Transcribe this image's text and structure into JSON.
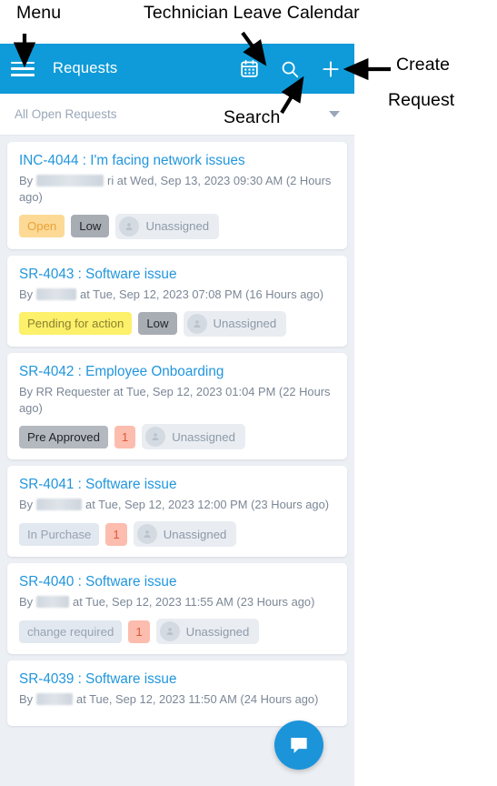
{
  "annotations": [
    {
      "key": "menu",
      "text": "Menu"
    },
    {
      "key": "calendar",
      "text": "Technician Leave Calendar"
    },
    {
      "key": "search",
      "text": "Search"
    },
    {
      "key": "create1",
      "text": "Create"
    },
    {
      "key": "create2",
      "text": "Request"
    }
  ],
  "header": {
    "title": "Requests",
    "menu_icon": "hamburger-menu-icon",
    "actions": [
      {
        "name": "calendar-icon",
        "label": "Technician Leave Calendar"
      },
      {
        "name": "search-icon",
        "label": "Search"
      },
      {
        "name": "plus-icon",
        "label": "Create Request"
      }
    ]
  },
  "filter_bar": {
    "selected": "All Open Requests",
    "caret_icon": "chevron-down-icon"
  },
  "colors": {
    "header_blue": "#0f9bd9",
    "title_blue": "#2196dd",
    "fab_blue": "#1b94da",
    "page_bg": "#eceff3",
    "open_chip_bg": "#fcd995",
    "open_chip_text": "#e8a33a",
    "pending_chip_bg": "#fdf06a",
    "pending_chip_text": "#8a8330",
    "low_chip_bg": "#a8adb4",
    "low_chip_text": "#22262b",
    "preapproved_chip_bg": "#b4b9bf",
    "preapproved_chip_text": "#22262b",
    "muted_chip_bg": "#e2e8f0",
    "muted_chip_text": "#97a3b2",
    "prio_num_bg": "#fcbdae",
    "prio_num_text": "#e0563a",
    "assignee_bg": "#e9edf2",
    "assignee_text": "#8e9aa8"
  },
  "requests": [
    {
      "title": "INC-4044 : I'm facing network issues",
      "meta_prefix": "By",
      "redacted_width": 74,
      "meta_suffix": "ri at Wed, Sep 13, 2023 09:30 AM (2 Hours ago)",
      "status": {
        "label": "Open",
        "style": "open"
      },
      "priority": {
        "label": "Low",
        "style": "low"
      },
      "assignee": {
        "label": "Unassigned",
        "icon": "person-icon"
      }
    },
    {
      "title": "SR-4043 : Software issue",
      "meta_prefix": "By",
      "redacted_width": 44,
      "meta_suffix": "at Tue, Sep 12, 2023 07:08 PM (16 Hours ago)",
      "status": {
        "label": "Pending for action",
        "style": "pending"
      },
      "priority": {
        "label": "Low",
        "style": "low"
      },
      "assignee": {
        "label": "Unassigned",
        "icon": "person-icon"
      }
    },
    {
      "title": "SR-4042 : Employee Onboarding",
      "meta_prefix": "By RR Requester at Tue, Sep 12, 2023 01:04 PM (22 Hours ago)",
      "redacted_width": 0,
      "meta_suffix": "",
      "status": {
        "label": "Pre Approved",
        "style": "preapproved"
      },
      "priority": {
        "label": "1",
        "style": "num"
      },
      "assignee": {
        "label": "Unassigned",
        "icon": "person-icon"
      }
    },
    {
      "title": "SR-4041 : Software issue",
      "meta_prefix": "By",
      "redacted_width": 50,
      "meta_suffix": "at Tue, Sep 12, 2023 12:00 PM (23 Hours ago)",
      "status": {
        "label": "In Purchase",
        "style": "muted"
      },
      "priority": {
        "label": "1",
        "style": "num"
      },
      "assignee": {
        "label": "Unassigned",
        "icon": "person-icon"
      }
    },
    {
      "title": "SR-4040 : Software issue",
      "meta_prefix": "By",
      "redacted_width": 36,
      "meta_suffix": "at Tue, Sep 12, 2023 11:55 AM (23 Hours ago)",
      "status": {
        "label": "change required",
        "style": "muted"
      },
      "priority": {
        "label": "1",
        "style": "num"
      },
      "assignee": {
        "label": "Unassigned",
        "icon": "person-icon"
      }
    },
    {
      "title": "SR-4039 : Software issue",
      "meta_prefix": "By",
      "redacted_width": 40,
      "meta_suffix": "at Tue, Sep 12, 2023 11:50 AM (24 Hours ago)",
      "status": null,
      "priority": null,
      "assignee": null
    }
  ],
  "chat_fab": {
    "icon": "chat-bubble-icon"
  }
}
